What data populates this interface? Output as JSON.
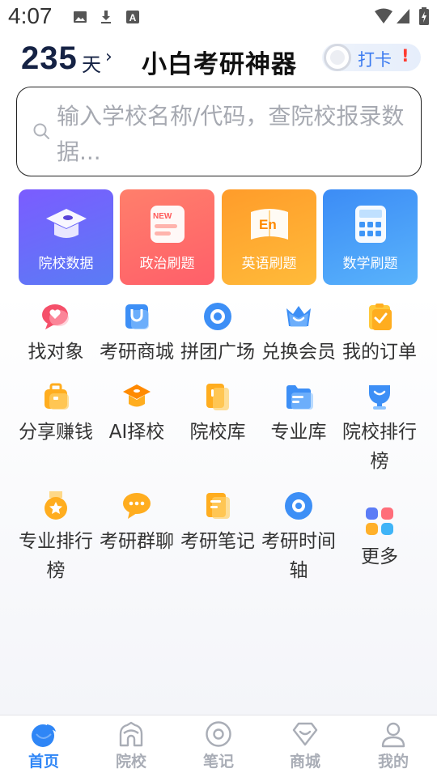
{
  "status_bar": {
    "time": "4:07",
    "icons": [
      "image-icon",
      "download-icon",
      "a-box-icon",
      "wifi-icon",
      "signal-icon",
      "battery-icon"
    ]
  },
  "header": {
    "days_count": "235",
    "days_unit": "天",
    "days_arrow": "›",
    "title": "小白考研神器",
    "checkin_label": "打卡",
    "checkin_alert": "!"
  },
  "search": {
    "placeholder": "输入学校名称/代码，查院校报录数据..."
  },
  "feature_cards": [
    {
      "label": "院校数据",
      "icon": "graduation-cap-icon",
      "color": "#6a5cf6"
    },
    {
      "label": "政治刷题",
      "icon": "new-document-icon",
      "color": "#ff6e66"
    },
    {
      "label": "英语刷题",
      "icon": "english-book-icon",
      "color": "#ffa62b"
    },
    {
      "label": "数学刷题",
      "icon": "calculator-icon",
      "color": "#3f96f7"
    }
  ],
  "grid": [
    {
      "label": "找对象",
      "icon": "heart-chat-icon"
    },
    {
      "label": "考研商城",
      "icon": "shopping-bag-icon"
    },
    {
      "label": "拼团广场",
      "icon": "circle-dot-icon"
    },
    {
      "label": "兑换会员",
      "icon": "crown-icon"
    },
    {
      "label": "我的订单",
      "icon": "order-check-icon"
    },
    {
      "label": "分享赚钱",
      "icon": "briefcase-icon"
    },
    {
      "label": "AI择校",
      "icon": "ai-cap-icon"
    },
    {
      "label": "院校库",
      "icon": "school-folder-icon"
    },
    {
      "label": "专业库",
      "icon": "major-folder-icon"
    },
    {
      "label": "院校排行榜",
      "icon": "trophy-icon"
    },
    {
      "label": "专业排行榜",
      "icon": "medal-icon"
    },
    {
      "label": "考研群聊",
      "icon": "group-chat-icon"
    },
    {
      "label": "考研笔记",
      "icon": "notes-icon"
    },
    {
      "label": "考研时间轴",
      "icon": "timeline-dot-icon"
    },
    {
      "label": "更多",
      "icon": "more-apps-icon"
    }
  ],
  "bottom_nav": [
    {
      "label": "首页",
      "icon": "home-fish-icon",
      "active": true
    },
    {
      "label": "院校",
      "icon": "school-icon",
      "active": false
    },
    {
      "label": "笔记",
      "icon": "notes-circle-icon",
      "active": false
    },
    {
      "label": "商城",
      "icon": "mall-heart-icon",
      "active": false
    },
    {
      "label": "我的",
      "icon": "profile-icon",
      "active": false
    }
  ],
  "colors": {
    "accent": "#2f86f6",
    "title_dark": "#152244",
    "alert": "#ff3b30"
  }
}
